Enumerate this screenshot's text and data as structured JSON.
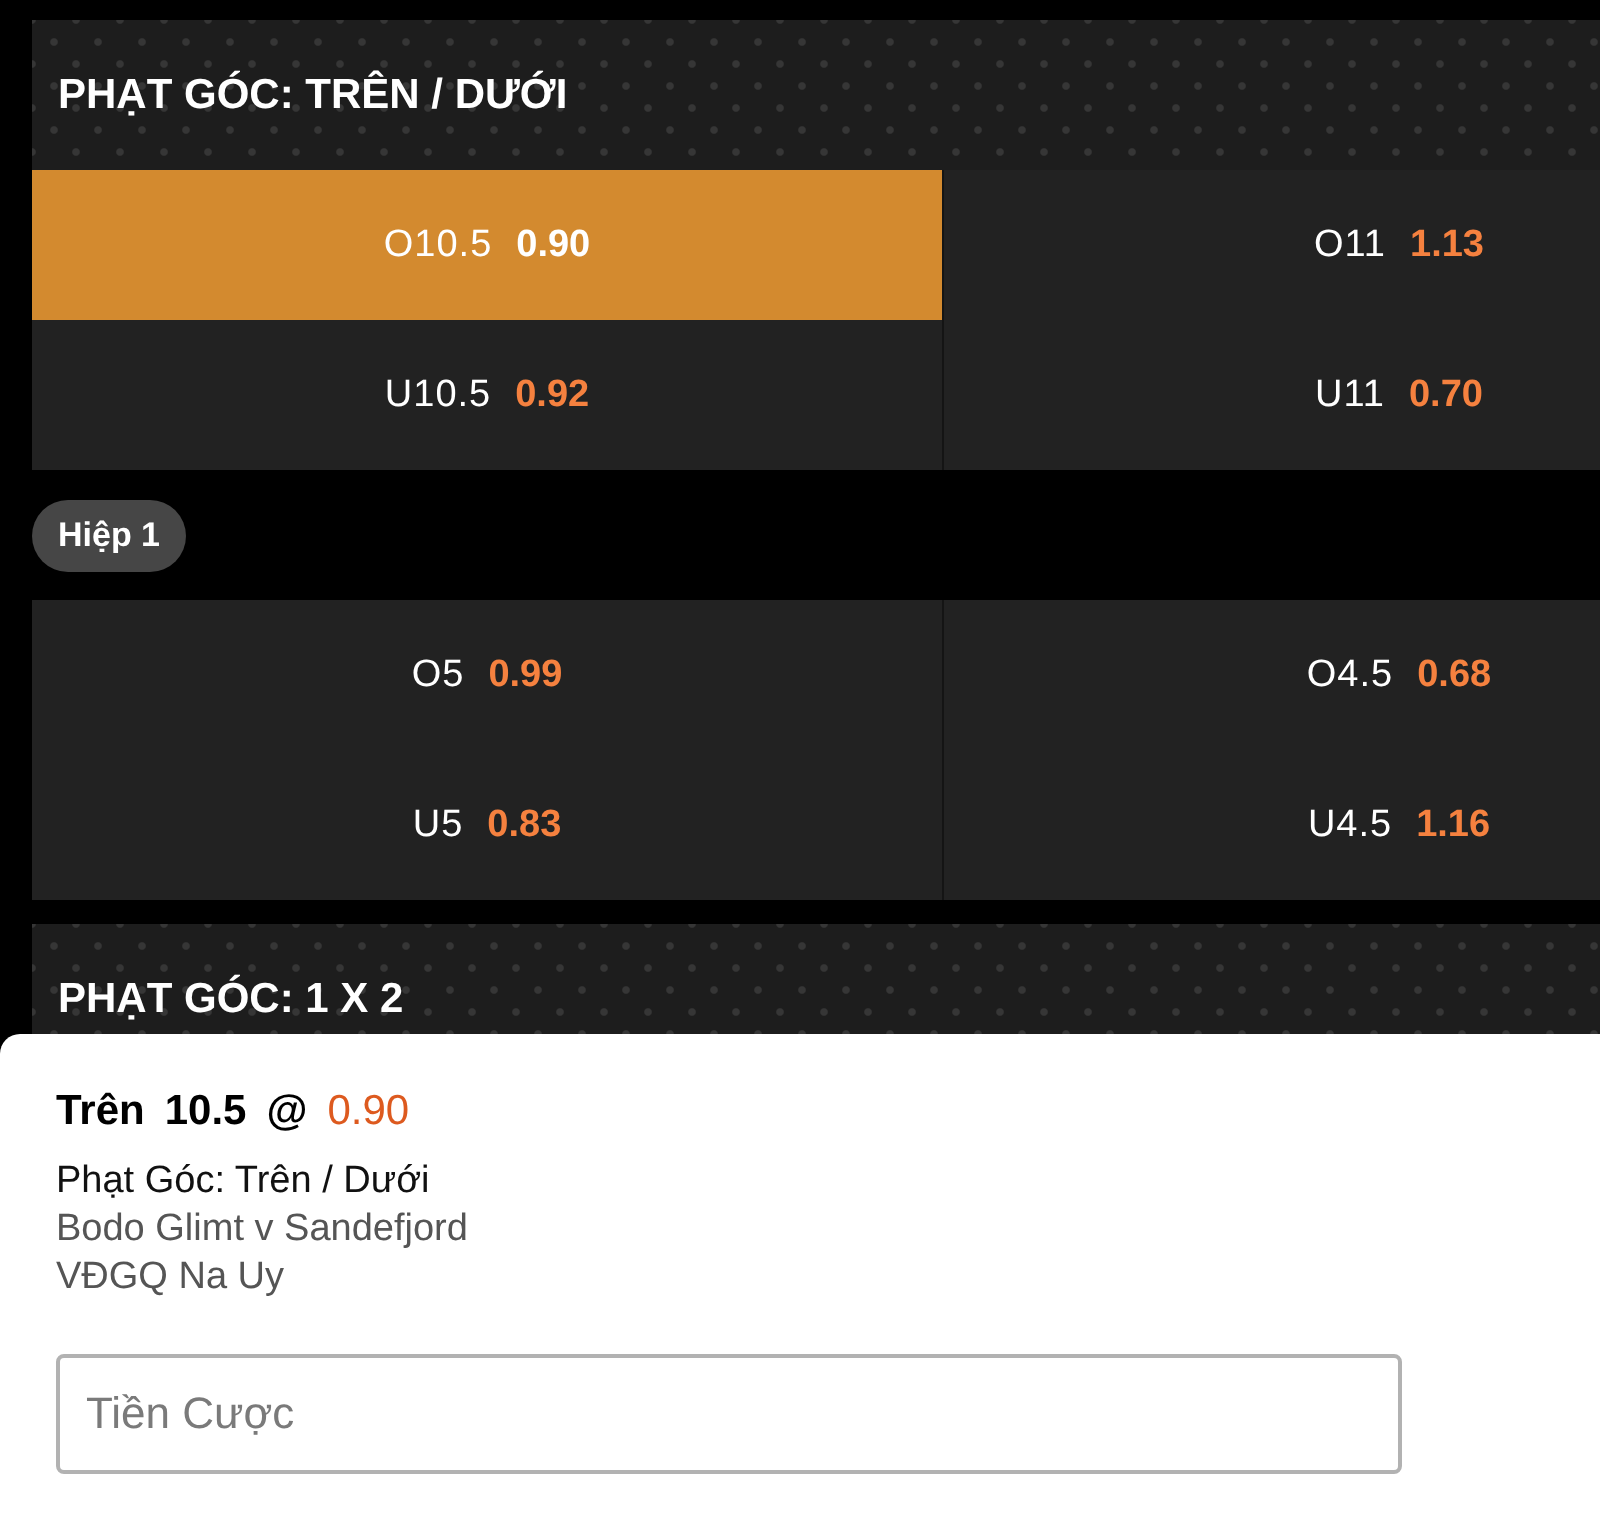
{
  "sections": [
    {
      "kind": "header",
      "title": "PHẠT GÓC: TRÊN / DƯỚI"
    },
    {
      "kind": "odds_grid",
      "rows": [
        {
          "cells": [
            {
              "label": "O10.5",
              "odds": "0.90",
              "selected": true
            },
            {
              "label": "O11",
              "odds": "1.13",
              "selected": false
            }
          ]
        },
        {
          "cells": [
            {
              "label": "U10.5",
              "odds": "0.92",
              "selected": false
            },
            {
              "label": "U11",
              "odds": "0.70",
              "selected": false
            }
          ]
        }
      ]
    },
    {
      "kind": "period_tag",
      "label": "Hiệp 1"
    },
    {
      "kind": "odds_grid",
      "rows": [
        {
          "cells": [
            {
              "label": "O5",
              "odds": "0.99",
              "selected": false
            },
            {
              "label": "O4.5",
              "odds": "0.68",
              "selected": false
            }
          ]
        },
        {
          "cells": [
            {
              "label": "U5",
              "odds": "0.83",
              "selected": false
            },
            {
              "label": "U4.5",
              "odds": "1.16",
              "selected": false
            }
          ]
        }
      ]
    },
    {
      "kind": "header",
      "title": "PHẠT GÓC: 1 X 2"
    }
  ],
  "bet_slip": {
    "selection": "Trên",
    "line": "10.5",
    "at": "@",
    "odds": "0.90",
    "market": "Phạt Góc: Trên / Dưới",
    "event": "Bodo Glimt v Sandefjord",
    "league": "VĐGQ Na Uy",
    "stake": {
      "placeholder": "Tiền Cược"
    }
  }
}
